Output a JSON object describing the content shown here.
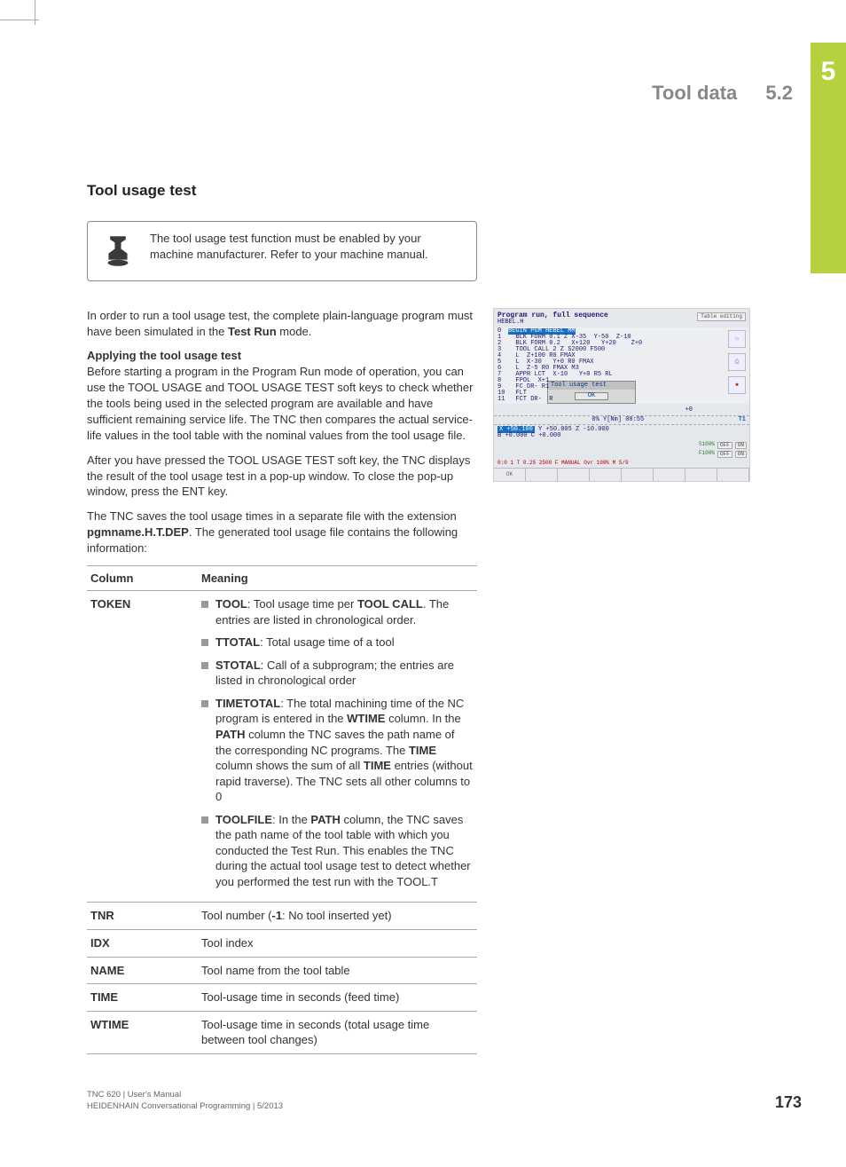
{
  "chapter_tab": "5",
  "header": {
    "title": "Tool data",
    "section": "5.2"
  },
  "section_title": "Tool usage test",
  "note": "The tool usage test function must be enabled by your machine manufacturer. Refer to your machine manual.",
  "para1_before": "In order to run a tool usage test, the complete plain-language program must have been simulated in the ",
  "para1_bold": "Test Run",
  "para1_after": " mode.",
  "sub1": "Applying the tool usage test",
  "para2": "Before starting a program in the Program Run mode of operation, you can use the TOOL USAGE and TOOL USAGE TEST soft keys to check whether the tools being used in the selected program are available and have sufficient remaining service life. The TNC then compares the actual service-life values in the tool table with the nominal values from the tool usage file.",
  "para3": "After you have pressed the TOOL USAGE TEST soft key, the TNC displays the result of the tool usage test in a pop-up window. To close the pop-up window, press the ENT key.",
  "para4_before": "The TNC saves the tool usage times in a separate file with the extension ",
  "para4_bold": "pgmname.H.T.DEP",
  "para4_after": ". The generated tool usage file contains the following information:",
  "table": {
    "headers": [
      "Column",
      "Meaning"
    ],
    "rows": {
      "token": {
        "col": "TOKEN",
        "items": [
          {
            "b1": "TOOL",
            "t1": ": Tool usage time per ",
            "b2": "TOOL CALL",
            "t2": ". The entries are listed in chronological order."
          },
          {
            "b1": "TTOTAL",
            "t1": ": Total usage time of a tool"
          },
          {
            "b1": "STOTAL",
            "t1": ": Call of a subprogram; the entries are listed in chronological order"
          },
          {
            "b1": "TIMETOTAL",
            "t1": ": The total machining time of the NC program is entered in the ",
            "b2": "WTIME",
            "t2": " column. In the ",
            "b3": "PATH",
            "t3": " column the TNC saves the path name of the corresponding NC programs. The ",
            "b4": "TIME",
            "t4": " column shows the sum of all ",
            "b5": "TIME",
            "t5": " entries (without rapid traverse). The TNC sets all other columns to 0"
          },
          {
            "b1": "TOOLFILE",
            "t1": ": In the ",
            "b2": "PATH",
            "t2": " column, the TNC saves the path name of the tool table with which you conducted the Test Run. This enables the TNC during the actual tool usage test to detect whether you performed the test run with the TOOL.T"
          }
        ]
      },
      "tnr": {
        "col": "TNR",
        "before": "Tool number (",
        "bold": "-1",
        "after": ": No tool inserted yet)"
      },
      "idx": {
        "col": "IDX",
        "text": "Tool index"
      },
      "name": {
        "col": "NAME",
        "text": "Tool name from the tool table"
      },
      "time": {
        "col": "TIME",
        "text": "Tool-usage time in seconds (feed time)"
      },
      "wtime": {
        "col": "WTIME",
        "text": "Tool-usage time in seconds (total usage time between tool changes)"
      }
    }
  },
  "screenshot": {
    "title": "Program run, full sequence",
    "tab": "Table editing",
    "file": "HEBEL.H",
    "hi_line": " BEGIN PGM HEBEL MM",
    "lines": [
      "  BLK FORM 0.1 Z X-35  Y-50  Z-10",
      "  BLK FORM 0.2   X+120   Y+20    Z+0",
      "  TOOL CALL 2 Z S2000 F500",
      "  L  Z+100 R0 FMAX",
      "  L  X-30   Y+0 R0 FMAX",
      "  L  Z-5 R0 FMAX M3",
      "  APPR LCT  X-10   Y+0 R5 RL",
      "  FPOL  X+1",
      "  FC DR- R1",
      "  FLT",
      "  FCT DR-  R"
    ],
    "dlg_title": "Tool usage test",
    "dlg_btn": "OK",
    "status1": "0% Y[Nm] 08:55",
    "axes": {
      "x": "X  +50.100",
      "y": "Y   +50.005",
      "z": "Z   -10.000",
      "b": "B   +0.000",
      "c": "C    +0.000"
    },
    "ovr": {
      "s_label": "S100%",
      "f_label": "F100%",
      "off": "OFF",
      "on": "ON"
    },
    "soft_ok": "OK",
    "bottom": "0:0 1    T   0.25 2500 F   MANUAL   Ovr 100% M 5/9",
    "t_right": "+0",
    "t_label": "T1"
  },
  "footer": {
    "line1": "TNC 620 | User's Manual",
    "line2": "HEIDENHAIN Conversational Programming | 5/2013",
    "page": "173"
  }
}
